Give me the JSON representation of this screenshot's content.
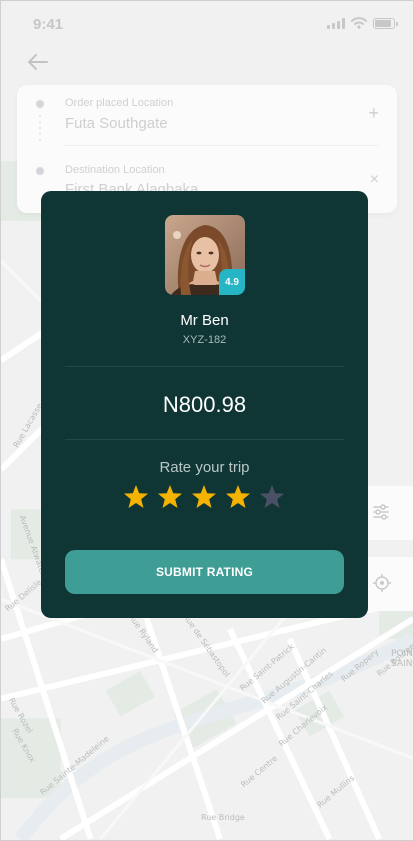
{
  "status_bar": {
    "time": "9:41"
  },
  "location": {
    "origin_label": "Order placed Location",
    "origin_value": "Futa Southgate",
    "destination_label": "Destination Location",
    "destination_value": "First Bank Alagbaka"
  },
  "map_labels": [
    "Rue Saint-Patrick",
    "Rue Augustin-Cantin",
    "Rue Saint-Charles",
    "Rue Charlevoix",
    "Rue Centre",
    "Rue Mullins",
    "Rue Ryland",
    "Rue de Sébastopol",
    "Rue Sainte-Madeleine",
    "Rue Ropery",
    "Rue Knox",
    "Avenue Atwater",
    "Rue Delisle",
    "Rue Lacasse",
    "Rue Rozel",
    "Rue Bourgeoys",
    "Rue Bridge",
    "POIN\nSAIN"
  ],
  "modal": {
    "driver_rating": "4.9",
    "driver_name": "Mr Ben",
    "plate": "XYZ-182",
    "fare": "N800.98",
    "rate_prompt": "Rate your trip",
    "stars_selected": 4,
    "stars_total": 5,
    "submit_label": "SUBMIT RATING"
  },
  "colors": {
    "modal_bg": "#0f3635",
    "accent": "#3e9d95",
    "badge": "#25b5c4",
    "star_active": "#f5b301",
    "star_inactive": "#4a5166"
  }
}
